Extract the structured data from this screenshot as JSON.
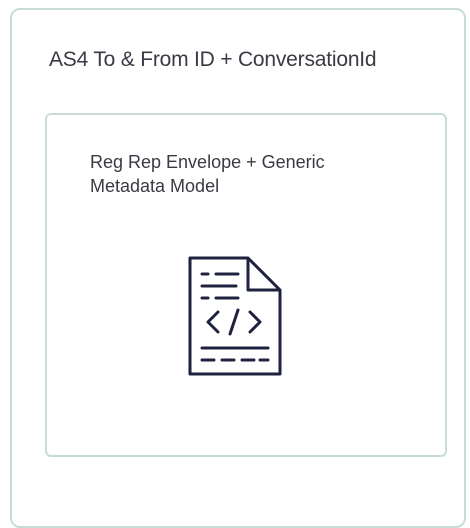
{
  "outer_box": {
    "title": "AS4 To & From ID + ConversationId"
  },
  "inner_box": {
    "title_line1": "Reg Rep Envelope + Generic",
    "title_line2": "Metadata Model",
    "icon": "code-document-icon"
  },
  "colors": {
    "border": "#c8ddd2",
    "text": "#3a3a44",
    "icon_stroke": "#1e2240"
  }
}
